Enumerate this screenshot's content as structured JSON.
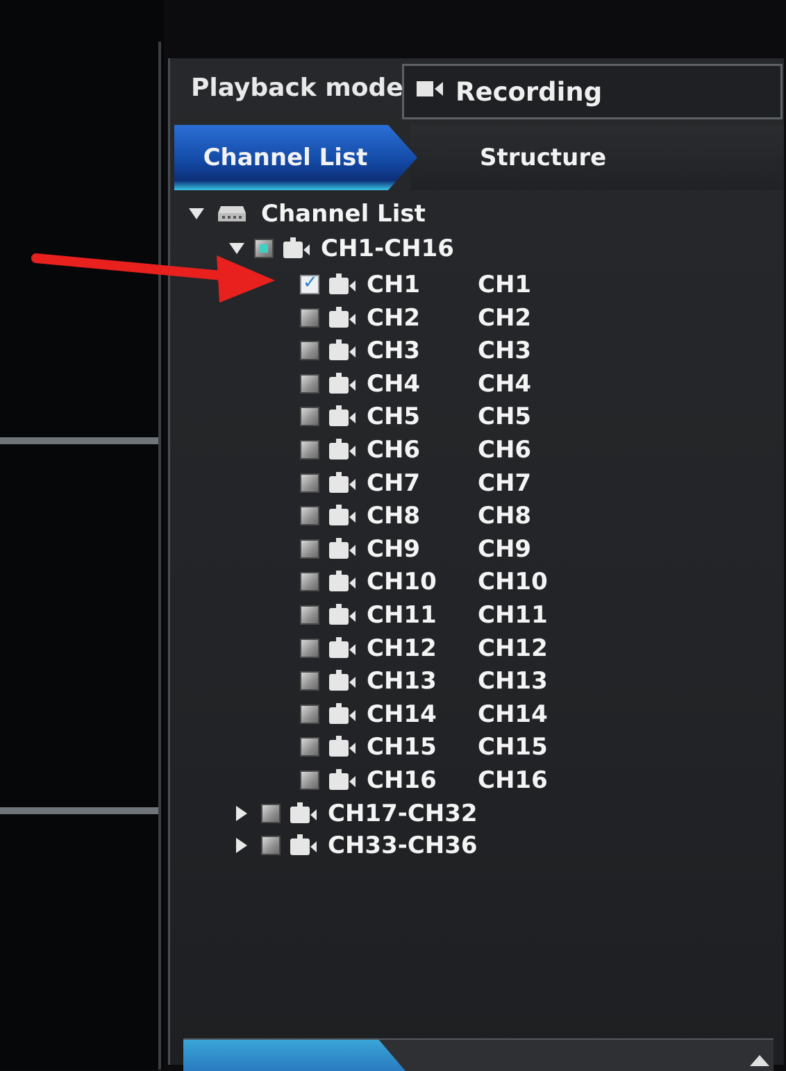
{
  "playback": {
    "label": "Playback mode:",
    "mode": "Recording",
    "mode_icon": "video-camera-icon"
  },
  "tabs": [
    {
      "label": "Channel List",
      "active": true
    },
    {
      "label": "Structure",
      "active": false
    }
  ],
  "tree": {
    "root_label": "Channel List",
    "root_icon": "dvr-device-icon",
    "groups": [
      {
        "label": "CH1-CH16",
        "expanded": true,
        "check_state": "partial"
      },
      {
        "label": "CH17-CH32",
        "expanded": false,
        "check_state": "unchecked"
      },
      {
        "label": "CH33-CH36",
        "expanded": false,
        "check_state": "unchecked"
      }
    ],
    "channels": [
      {
        "name": "CH1",
        "alias": "CH1",
        "checked": true
      },
      {
        "name": "CH2",
        "alias": "CH2",
        "checked": false
      },
      {
        "name": "CH3",
        "alias": "CH3",
        "checked": false
      },
      {
        "name": "CH4",
        "alias": "CH4",
        "checked": false
      },
      {
        "name": "CH5",
        "alias": "CH5",
        "checked": false
      },
      {
        "name": "CH6",
        "alias": "CH6",
        "checked": false
      },
      {
        "name": "CH7",
        "alias": "CH7",
        "checked": false
      },
      {
        "name": "CH8",
        "alias": "CH8",
        "checked": false
      },
      {
        "name": "CH9",
        "alias": "CH9",
        "checked": false
      },
      {
        "name": "CH10",
        "alias": "CH10",
        "checked": false
      },
      {
        "name": "CH11",
        "alias": "CH11",
        "checked": false
      },
      {
        "name": "CH12",
        "alias": "CH12",
        "checked": false
      },
      {
        "name": "CH13",
        "alias": "CH13",
        "checked": false
      },
      {
        "name": "CH14",
        "alias": "CH14",
        "checked": false
      },
      {
        "name": "CH15",
        "alias": "CH15",
        "checked": false
      },
      {
        "name": "CH16",
        "alias": "CH16",
        "checked": false
      }
    ]
  },
  "colors": {
    "active_tab": "#134aa6",
    "annotation_arrow": "#e8201e",
    "checkbox_partial": "#3fd0c4"
  }
}
